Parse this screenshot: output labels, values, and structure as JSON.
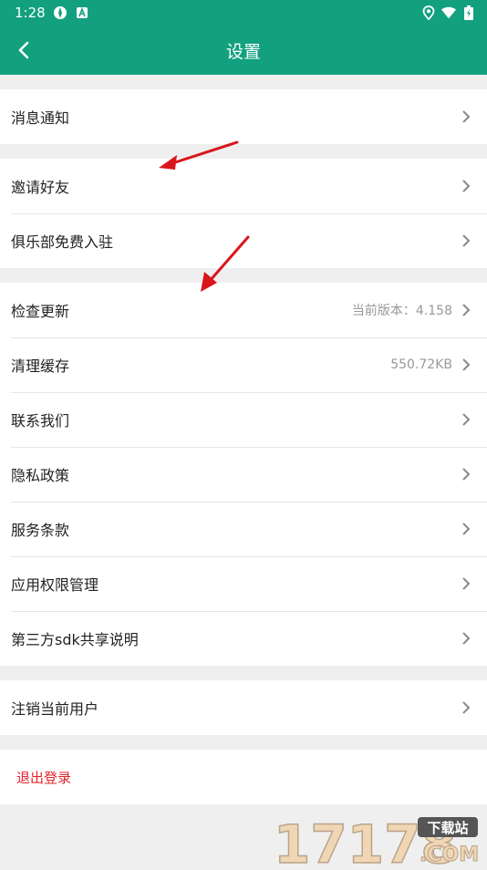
{
  "status": {
    "time": "1:28"
  },
  "header": {
    "title": "设置"
  },
  "groups": [
    [
      {
        "label": "消息通知"
      }
    ],
    [
      {
        "label": "邀请好友"
      },
      {
        "label": "俱乐部免费入驻"
      }
    ],
    [
      {
        "label": "检查更新",
        "value": "当前版本：4.158"
      },
      {
        "label": "清理缓存",
        "value": "550.72KB"
      },
      {
        "label": "联系我们"
      },
      {
        "label": "隐私政策"
      },
      {
        "label": "服务条款"
      },
      {
        "label": "应用权限管理"
      },
      {
        "label": "第三方sdk共享说明"
      }
    ],
    [
      {
        "label": "注销当前用户"
      }
    ]
  ],
  "logout": {
    "label": "退出登录"
  },
  "watermark": {
    "number": "17178",
    "tag": "下载站",
    "domain": ".COM"
  },
  "colors": {
    "primary": "#13a07f",
    "danger": "#e0252c",
    "annotation": "#d9161c"
  }
}
